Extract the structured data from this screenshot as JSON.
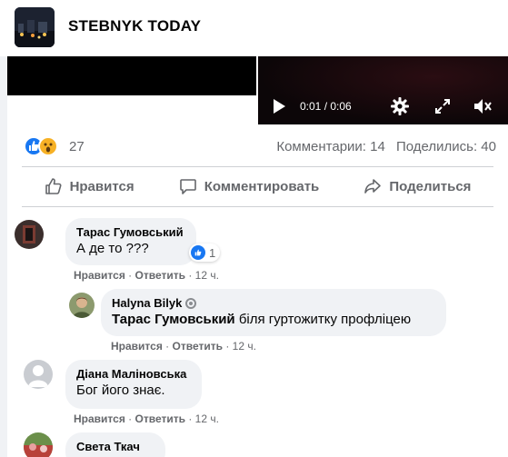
{
  "page": {
    "name": "STEBNYK TODAY"
  },
  "video": {
    "time": "0:01 / 0:06",
    "icons": [
      "play-icon",
      "gear-icon",
      "fullscreen-icon",
      "muted-speaker-icon"
    ]
  },
  "reactions": {
    "count": "27",
    "icons": [
      "like-reaction-icon",
      "wow-reaction-icon"
    ]
  },
  "stats": {
    "comments": "Комментарии: 14",
    "shares": "Поделились: 40"
  },
  "actions": {
    "like": "Нравится",
    "comment": "Комментировать",
    "share": "Поделиться"
  },
  "comments": [
    {
      "author": "Тарас Гумовський",
      "text": "А де то ???",
      "like_label": "Нравится",
      "reply_label": "Ответить",
      "time": "12 ч.",
      "reaction_count": "1"
    },
    {
      "author": "Halyna Bilyk",
      "mention": "Тарас Гумовський",
      "text": "біля гуртожитку профліцею",
      "like_label": "Нравится",
      "reply_label": "Ответить",
      "time": "12 ч."
    },
    {
      "author": "Діана Маліновська",
      "text": "Бог його знає.",
      "like_label": "Нравится",
      "reply_label": "Ответить",
      "time": "12 ч."
    },
    {
      "author": "Света Ткач"
    }
  ],
  "colors": {
    "accent": "#1877f2",
    "text": "#050505",
    "secondary": "#65676b",
    "bubble": "#f0f2f5"
  }
}
